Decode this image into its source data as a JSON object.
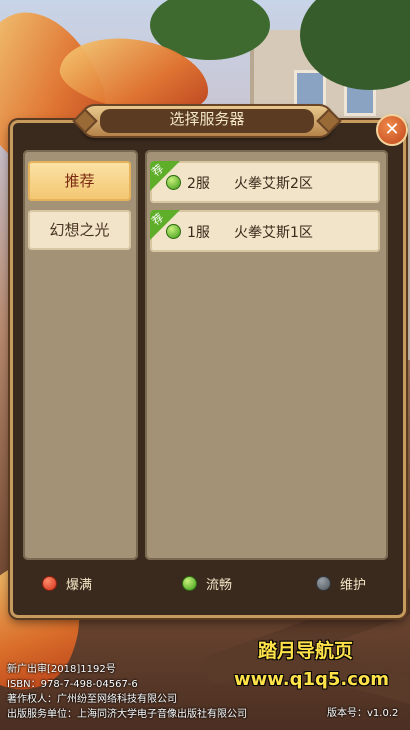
{
  "dialog": {
    "title": "选择服务器",
    "close_icon": "close-icon"
  },
  "tabs": [
    {
      "label": "推荐",
      "active": true
    },
    {
      "label": "幻想之光",
      "active": false
    }
  ],
  "servers": [
    {
      "tag": "荐",
      "status": "green",
      "number": "2服",
      "name": "火拳艾斯2区"
    },
    {
      "tag": "荐",
      "status": "green",
      "number": "1服",
      "name": "火拳艾斯1区"
    }
  ],
  "legend": [
    {
      "label": "爆满",
      "color": "#d0321a"
    },
    {
      "label": "流畅",
      "color": "#3c9a18"
    },
    {
      "label": "维护",
      "color": "#4e555c"
    }
  ],
  "footer": {
    "line1": "新广出审[2018]1192号",
    "line2": "ISBN：978-7-498-04567-6",
    "line3": "著作权人：广州纷至网络科技有限公司",
    "line4": "出版服务单位：上海同济大学电子音像出版社有限公司",
    "version": "版本号：v1.0.2"
  },
  "watermark": {
    "title": "踏月导航页",
    "url": "www.q1q5.com"
  }
}
